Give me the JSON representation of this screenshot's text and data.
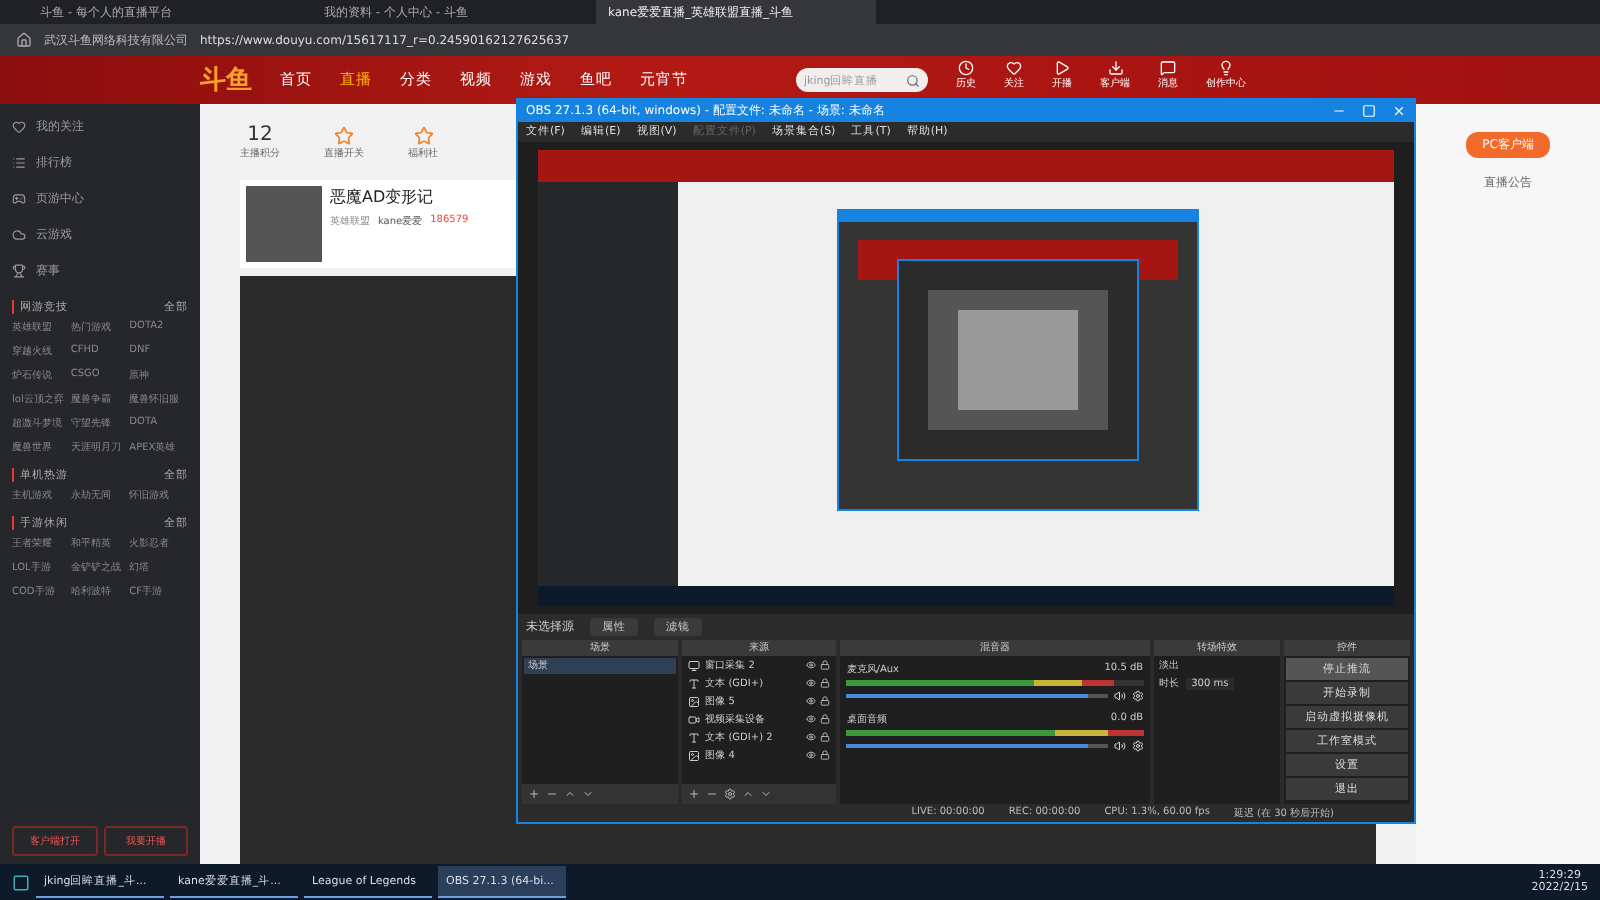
{
  "browser": {
    "tabs": [
      {
        "label": "斗鱼 - 每个人的直播平台",
        "selected": false
      },
      {
        "label": "我的资料 - 个人中心 - 斗鱼",
        "selected": false
      },
      {
        "label": "kane爱爱直播_英雄联盟直播_斗鱼",
        "selected": true
      }
    ],
    "site_name": "武汉斗鱼网络科技有限公司",
    "url": "https://www.douyu.com/15617117_r=0.24590162127625637"
  },
  "site": {
    "logo": "斗鱼",
    "nav": [
      {
        "label": "首页",
        "selected": false
      },
      {
        "label": "直播",
        "selected": true
      },
      {
        "label": "分类",
        "selected": false
      },
      {
        "label": "视频",
        "selected": false
      },
      {
        "label": "游戏",
        "selected": false
      },
      {
        "label": "鱼吧",
        "selected": false
      },
      {
        "label": "元宵节",
        "selected": false
      }
    ],
    "search": {
      "placeholder": "jking回眸直播"
    },
    "actions": [
      "历史",
      "关注",
      "开播",
      "客户端",
      "消息",
      "创作中心"
    ]
  },
  "sidebar": {
    "items": [
      "我的关注",
      "排行榜",
      "页游中心",
      "云游戏",
      "赛事"
    ],
    "sections": [
      {
        "title": "网游竞技",
        "more": "全部",
        "games": [
          "英雄联盟",
          "热门游戏",
          "DOTA2",
          "穿越火线",
          "CFHD",
          "DNF",
          "炉石传说",
          "CSGO",
          "原神",
          "lol云顶之弈",
          "魔兽争霸",
          "魔兽怀旧服",
          "超激斗梦境",
          "守望先锋",
          "DOTA",
          "魔兽世界",
          "天涯明月刀",
          "APEX英雄"
        ]
      },
      {
        "title": "单机热游",
        "more": "全部",
        "games": [
          "主机游戏",
          "永劫无间",
          "怀旧游戏"
        ]
      },
      {
        "title": "手游休闲",
        "more": "全部",
        "games": [
          "王者荣耀",
          "和平精英",
          "火影忍者",
          "LOL手游",
          "金铲铲之战",
          "幻塔",
          "COD手游",
          "哈利波特",
          "CF手游"
        ]
      }
    ],
    "buttons": [
      "客户端打开",
      "我要开播"
    ]
  },
  "dashboard": {
    "stats": [
      {
        "value": "12",
        "label": "主播积分"
      },
      {
        "label": "直播开关"
      },
      {
        "label": "福利社"
      }
    ],
    "streamer": {
      "name": "恶魔AD变形记",
      "category": "英雄联盟",
      "host": "kane爱爱",
      "heat": "186579"
    }
  },
  "right_panel": {
    "client_button": "PC客户端",
    "notice": "直播公告"
  },
  "obs": {
    "title": "OBS 27.1.3 (64-bit, windows) - 配置文件: 未命名 - 场景: 未命名",
    "menu": [
      {
        "label": "文件(F)",
        "disabled": false
      },
      {
        "label": "编辑(E)",
        "disabled": false
      },
      {
        "label": "视图(V)",
        "disabled": false
      },
      {
        "label": "配置文件(P)",
        "disabled": true
      },
      {
        "label": "场景集合(S)",
        "disabled": false
      },
      {
        "label": "工具(T)",
        "disabled": false
      },
      {
        "label": "帮助(H)",
        "disabled": false
      }
    ],
    "source_bar": {
      "label": "未选择源",
      "buttons": [
        "属性",
        "滤镜"
      ]
    },
    "docks": {
      "scenes": "场景",
      "sources": "来源",
      "mixer": "混音器",
      "transitions": "转场特效",
      "controls": "控件"
    },
    "scenes": [
      {
        "label": "场景",
        "selected": true
      }
    ],
    "sources": [
      {
        "label": "窗口采集 2",
        "kind": "window"
      },
      {
        "label": "文本 (GDI+)",
        "kind": "text"
      },
      {
        "label": "图像 5",
        "kind": "image"
      },
      {
        "label": "视频采集设备",
        "kind": "camera"
      },
      {
        "label": "文本 (GDI+) 2",
        "kind": "text"
      },
      {
        "label": "图像 4",
        "kind": "image"
      }
    ],
    "mixer": [
      {
        "name": "麦克风/Aux",
        "reading": "10.5 dB",
        "level": 0.9,
        "volume": {
          "level": 0.93
        }
      },
      {
        "name": "桌面音频",
        "reading": "0.0 dB",
        "level": 1,
        "volume": {
          "level": 0.93
        }
      }
    ],
    "transition": {
      "value": "淡出",
      "duration_label": "时长",
      "duration": "300 ms"
    },
    "controls": [
      {
        "label": "停止推流",
        "selected": true
      },
      {
        "label": "开始录制",
        "selected": false
      },
      {
        "label": "启动虚拟摄像机",
        "selected": false
      },
      {
        "label": "工作室模式",
        "selected": false
      },
      {
        "label": "设置",
        "selected": false
      },
      {
        "label": "退出",
        "selected": false
      }
    ],
    "status": {
      "live": "LIVE: 00:00:00",
      "rec": "REC: 00:00:00",
      "cpu": "CPU: 1.3%, 60.00 fps",
      "delay": "延迟 (在 30 秒后开始)"
    }
  },
  "taskbar": {
    "items": [
      {
        "label": "jking回眸直播_斗...",
        "selected": false
      },
      {
        "label": "kane爱爱直播_斗...",
        "selected": false
      },
      {
        "label": "League of Legends",
        "selected": false
      },
      {
        "label": "OBS 27.1.3 (64-bi...",
        "selected": true
      }
    ],
    "time": "1:29:29",
    "date": "2022/2/15"
  }
}
